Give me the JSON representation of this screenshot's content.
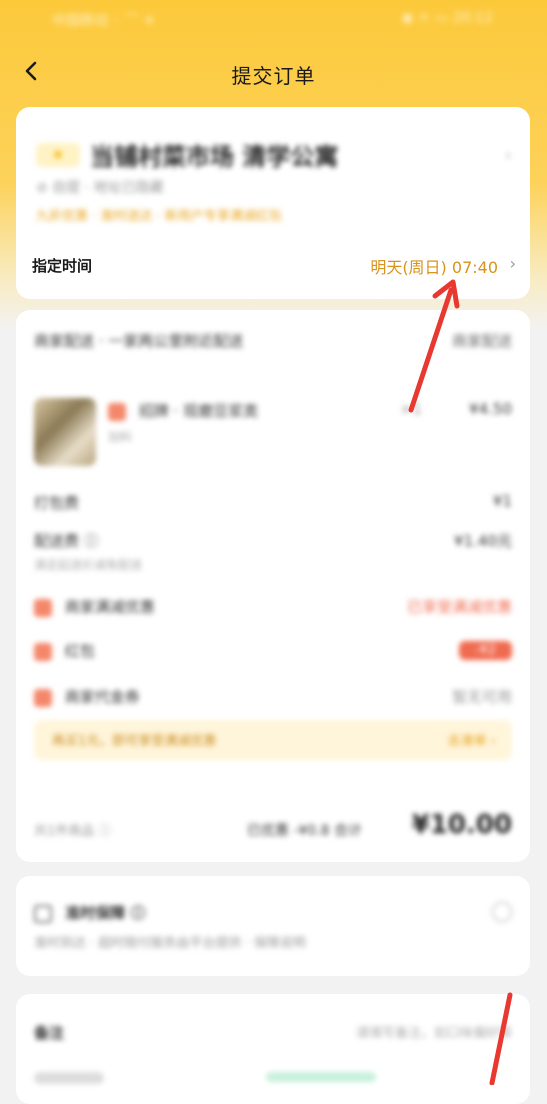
{
  "status_bar": {
    "left_text": "中国移动 ◦ ⌒ ✈",
    "right_text": "◉ ⚛ ▭ 20:12"
  },
  "nav": {
    "title": "提交订单"
  },
  "store": {
    "logo_text": "★",
    "name": "当铺村菜市场 清学公寓",
    "subtitle": "⊘ 自提 · 地址已隐藏",
    "tags": "九折优惠 · 准时送达 · 新用户专享满减红包",
    "time_label": "指定时间",
    "time_value": "明天(周日) 07:40"
  },
  "order": {
    "header": "商家配送 · 一家两公里附近配送",
    "header_right": "商家配送",
    "item_name": "招牌 · 现磨豆浆类",
    "item_sub": "加料",
    "item_qty": "×1",
    "item_price": "¥4.50",
    "packing_label": "打包费",
    "packing_value": "¥1",
    "delivery_label": "配送费 ⓘ",
    "delivery_value": "¥1.40元",
    "delivery_note": "满足起送价减免配送",
    "promo1_label": "商家满减优惠",
    "promo1_value": "已享受满减优惠",
    "promo2_label": "红包",
    "promo2_value": "-¥2",
    "promo3_label": "商家代金券",
    "promo3_value": "暂无可用",
    "notice_text": "再买1元，即可享受满减优惠",
    "notice_action": "去凑单 ›",
    "total_label": "共1件商品 ⓘ",
    "total_discount": "已优惠 -¥0.8 合计",
    "total_price": "¥10.00"
  },
  "protect": {
    "title": "准时保障 ⓘ",
    "desc": "准时到达 · 超时赔付服务由平台提供 · 保障说明"
  },
  "remark": {
    "label": "备注",
    "placeholder": "请填写备注，如口味偏好等"
  },
  "colors": {
    "accent": "#fcc93a",
    "time_text": "#d9921a",
    "arrow": "#e8382f"
  }
}
